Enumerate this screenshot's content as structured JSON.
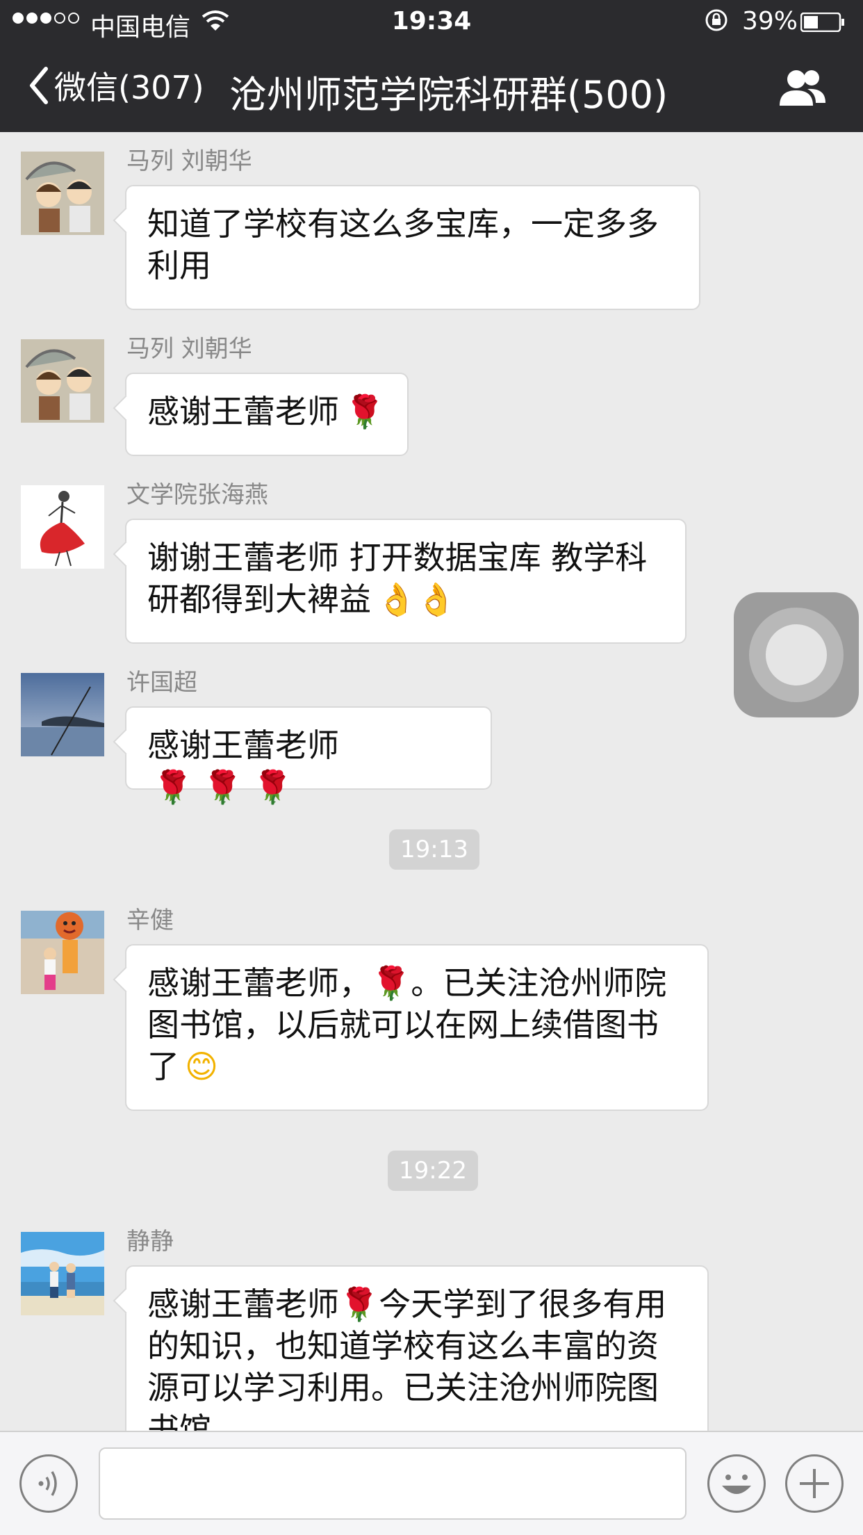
{
  "status_bar": {
    "carrier": "中国电信",
    "time": "19:34",
    "battery": "39%"
  },
  "nav": {
    "back_label": "微信(307)",
    "title": "沧州师范学院科研群(500)"
  },
  "messages": [
    {
      "sender": "马列 刘朝华",
      "text": "知道了学校有这么多宝库，一定多多利用",
      "emoji": ""
    },
    {
      "sender": "马列 刘朝华",
      "text": "感谢王蕾老师",
      "emoji": "🌹"
    },
    {
      "sender": "文学院张海燕",
      "text": "谢谢王蕾老师 打开数据宝库 教学科研都得到大裨益",
      "emoji": "👌👌"
    },
    {
      "sender": "许国超",
      "text": "感谢王蕾老师",
      "emoji": "🌹 🌹 🌹"
    },
    {
      "sender": "辛健",
      "text": "感谢王蕾老师，🌹。已关注沧州师院图书馆，以后就可以在网上续借图书了",
      "emoji": "😊"
    },
    {
      "sender": "静静",
      "text": "感谢王蕾老师🌹今天学到了很多有用的知识，也知道学校有这么丰富的资源可以学习利用。已关注沧州师院图书馆。",
      "emoji": ""
    }
  ],
  "timestamps": [
    "19:13",
    "19:22"
  ],
  "icons": {
    "back": "chevron-left-icon",
    "group": "people-icon",
    "voice": "voice-icon",
    "emoji": "smiley-icon",
    "plus": "plus-icon"
  },
  "colors": {
    "nav_bg": "#2b2b2e",
    "chat_bg": "#ebebeb",
    "bubble_bg": "#ffffff",
    "timestamp_bg": "#d3d3d3"
  }
}
